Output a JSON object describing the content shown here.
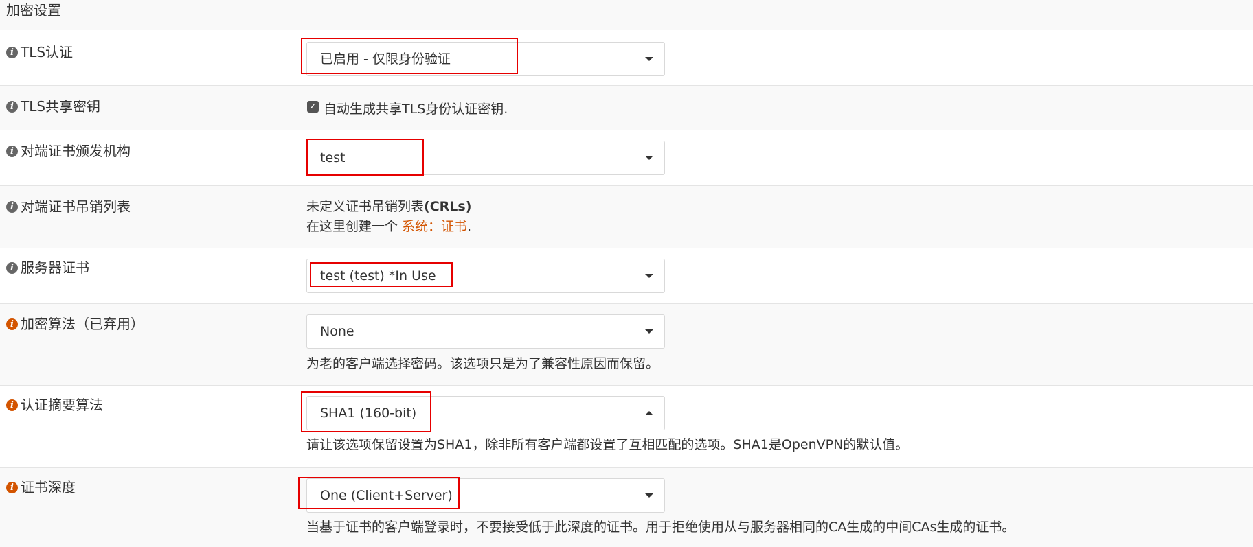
{
  "section": {
    "title": "加密设置"
  },
  "rows": {
    "tls_auth": {
      "label": "TLS认证",
      "icon": "info-icon",
      "select_value": "已启用 - 仅限身份验证"
    },
    "tls_key": {
      "label": "TLS共享密钥",
      "icon": "info-icon",
      "checkbox_checked": true,
      "checkbox_label": "自动生成共享TLS身份认证密钥."
    },
    "peer_ca": {
      "label": "对端证书颁发机构",
      "icon": "info-icon",
      "select_value": "test"
    },
    "peer_crl": {
      "label": "对端证书吊销列表",
      "icon": "info-icon",
      "line1_prefix": "未定义证书吊销列表",
      "line1_bold": "(CRLs)",
      "line2_prefix": "在这里创建一个 ",
      "line2_link": "系统：证书",
      "line2_suffix": "."
    },
    "server_cert": {
      "label": "服务器证书",
      "icon": "info-icon",
      "select_value": "test (test) *In Use"
    },
    "cipher": {
      "label": "加密算法（已弃用）",
      "icon": "info-icon-warning",
      "select_value": "None",
      "help": "为老的客户端选择密码。该选项只是为了兼容性原因而保留。"
    },
    "auth_digest": {
      "label": "认证摘要算法",
      "icon": "info-icon-warning",
      "select_value": "SHA1 (160-bit)",
      "help": "请让该选项保留设置为SHA1，除非所有客户端都设置了互相匹配的选项。SHA1是OpenVPN的默认值。"
    },
    "cert_depth": {
      "label": "证书深度",
      "icon": "info-icon-warning",
      "select_value": "One (Client+Server)",
      "help": "当基于证书的客户端登录时，不要接受低于此深度的证书。用于拒绝使用从与服务器相同的CA生成的中间CAs生成的证书。"
    }
  },
  "colors": {
    "highlight": "#e60000",
    "link": "#d35400",
    "warning_icon": "#d35400",
    "info_icon": "#666666"
  }
}
